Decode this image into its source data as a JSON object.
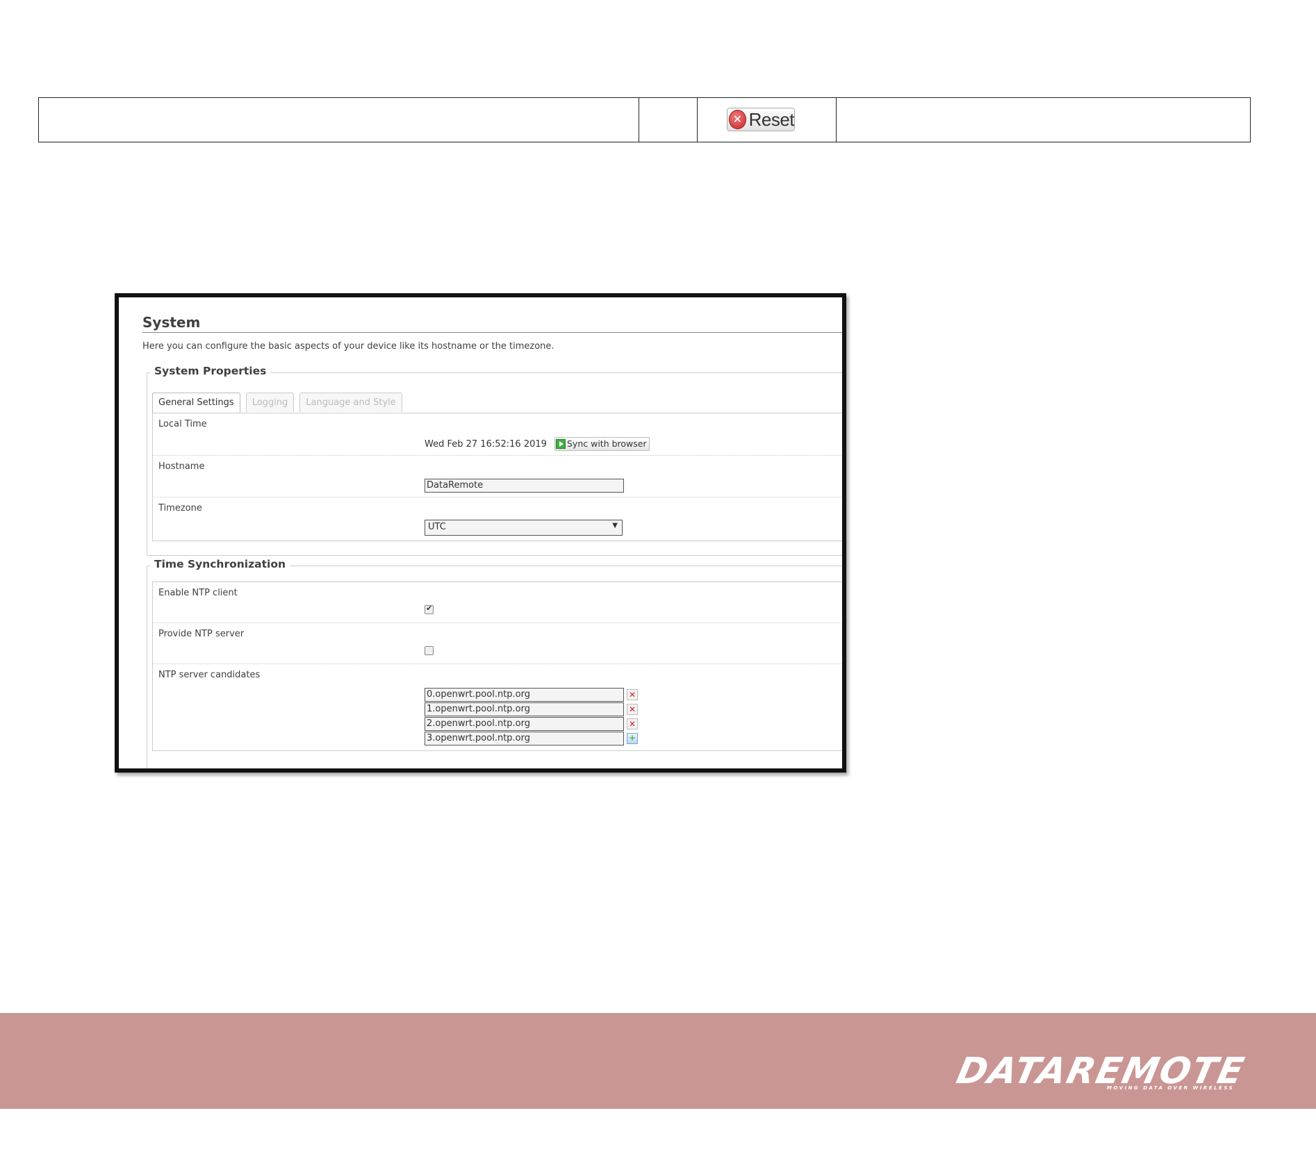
{
  "top_table": {
    "reset_label": "Reset"
  },
  "system": {
    "title": "System",
    "description": "Here you can configure the basic aspects of your device like its hostname or the timezone.",
    "properties_legend": "System Properties",
    "tabs": [
      {
        "label": "General Settings",
        "active": true
      },
      {
        "label": "Logging",
        "active": false
      },
      {
        "label": "Language and Style",
        "active": false
      }
    ],
    "local_time_label": "Local Time",
    "local_time_value": "Wed Feb 27 16:52:16 2019",
    "sync_label": "Sync with browser",
    "hostname_label": "Hostname",
    "hostname_value": "DataRemote",
    "timezone_label": "Timezone",
    "timezone_value": "UTC",
    "time_sync_legend": "Time Synchronization",
    "enable_ntp_label": "Enable NTP client",
    "enable_ntp_checked": true,
    "provide_ntp_label": "Provide NTP server",
    "provide_ntp_checked": false,
    "ntp_candidates_label": "NTP server candidates",
    "ntp_servers": [
      "0.openwrt.pool.ntp.org",
      "1.openwrt.pool.ntp.org",
      "2.openwrt.pool.ntp.org",
      "3.openwrt.pool.ntp.org"
    ]
  },
  "footer": {
    "brand": "DATAREMOTE",
    "tagline": "MOVING DATA OVER WIRELESS",
    "background_color": "#c99694"
  }
}
